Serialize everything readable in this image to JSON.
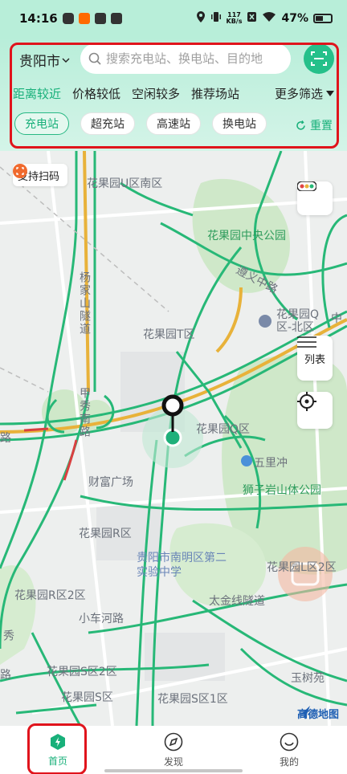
{
  "status": {
    "time": "14:16",
    "net_speed_value": "117",
    "net_speed_unit": "KB/s",
    "battery": "47%"
  },
  "header": {
    "city": "贵阳市",
    "search_placeholder": "搜索充电站、换电站、目的地",
    "sort_tabs": [
      "距离较近",
      "价格较低",
      "空闲较多",
      "推荐场站"
    ],
    "more_filter": "更多筛选",
    "chips": [
      "充电站",
      "超充站",
      "高速站",
      "换电站"
    ],
    "reset": "重置"
  },
  "map": {
    "scan_support": "支持扫码",
    "list_button": "列表",
    "labels": {
      "u_south": "花果园U区南区",
      "central_park": "花果园中央公园",
      "yangjia_tunnel": "杨家山隧道",
      "zunyi_road": "遵义中路",
      "q_north": "花果园Q区-北区",
      "t_zone": "花果园T区",
      "jiaxiu_road": "甲秀南路",
      "q_zone": "花果园Q区",
      "wulichong": "五里冲",
      "caifu": "财富广场",
      "shiziyan_park": "狮子岩山体公园",
      "r_zone": "花果园R区",
      "school": "贵阳市南明区第二实验中学",
      "l_zone": "花果园L区2区",
      "r_zone_2": "花果园R区2区",
      "taijin_tunnel": "太金线隧道",
      "xiaochehe_road": "小车河路",
      "s_zone_2": "花果园S区2区",
      "yushu_yuan": "玉树苑",
      "s_zone": "花果园S区",
      "s_zone_1": "花果园S区1区",
      "zhong": "中",
      "road_left": "路",
      "road_left_2": "路",
      "xiu": "秀"
    },
    "logo": "高德地图"
  },
  "nav": {
    "items": [
      {
        "label": "首页",
        "icon": "lightning-icon",
        "active": true
      },
      {
        "label": "发现",
        "icon": "compass-icon",
        "active": false
      },
      {
        "label": "我的",
        "icon": "smile-icon",
        "active": false
      }
    ]
  },
  "colors": {
    "accent": "#18b07a",
    "highlight": "#e0141c",
    "road_green": "#27b877",
    "road_yellow": "#e8b23a"
  }
}
